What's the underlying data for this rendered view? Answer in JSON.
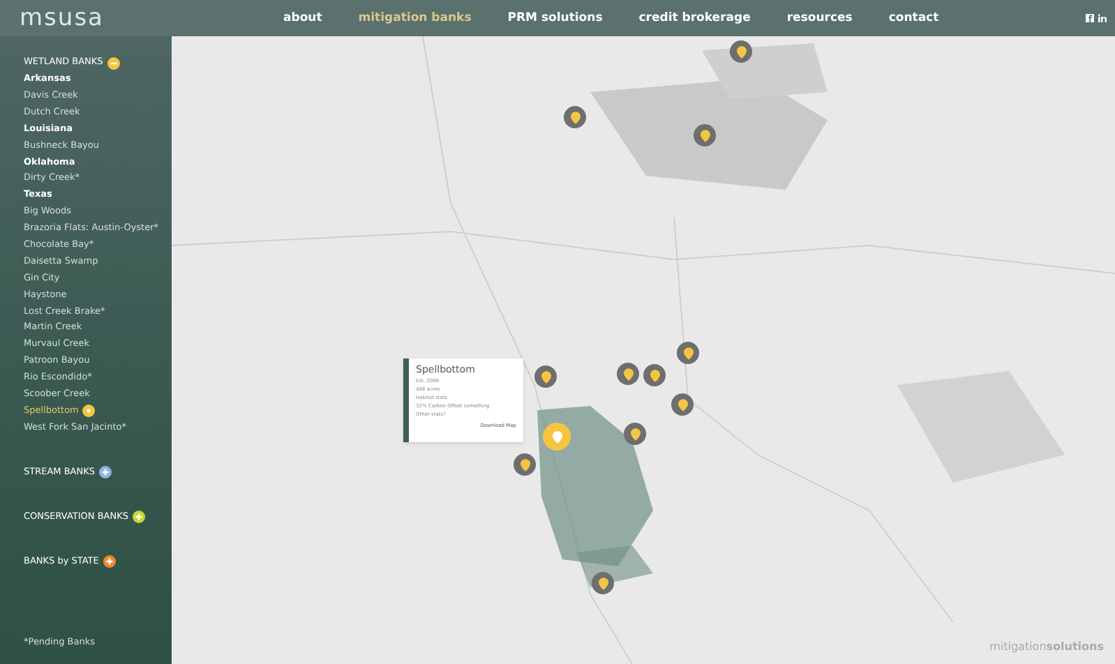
{
  "logo": "msusa",
  "nav": [
    {
      "label": "about",
      "selected": false
    },
    {
      "label": "mitigation banks",
      "selected": true
    },
    {
      "label": "PRM solutions",
      "selected": false
    },
    {
      "label": "credit brokerage",
      "selected": false
    },
    {
      "label": "resources",
      "selected": false
    },
    {
      "label": "contact",
      "selected": false
    }
  ],
  "sidebar": {
    "sections": [
      {
        "title": "WETLAND BANKS",
        "color": "#f5c542",
        "expanded": true,
        "items": [
          {
            "kind": "state",
            "label": "Arkansas"
          },
          {
            "kind": "bank",
            "label": "Davis Creek",
            "selected": false
          },
          {
            "kind": "bank",
            "label": "Dutch Creek",
            "selected": false
          },
          {
            "kind": "state",
            "label": "Louisiana"
          },
          {
            "kind": "bank",
            "label": "Bushneck Bayou",
            "selected": false
          },
          {
            "kind": "state",
            "label": "Oklahoma"
          },
          {
            "kind": "bank",
            "label": "Dirty Creek*",
            "selected": false
          },
          {
            "kind": "state",
            "label": "Texas"
          },
          {
            "kind": "bank",
            "label": "Big Woods",
            "selected": false
          },
          {
            "kind": "bank",
            "label": "Brazoria Flats: Austin-Oyster*",
            "selected": false
          },
          {
            "kind": "bank",
            "label": "Chocolate Bay*",
            "selected": false
          },
          {
            "kind": "bank",
            "label": "Daisetta Swamp",
            "selected": false
          },
          {
            "kind": "bank",
            "label": "Gin City",
            "selected": false
          },
          {
            "kind": "bank",
            "label": "Haystone",
            "selected": false
          },
          {
            "kind": "bank",
            "label": "Lost Creek Brake*",
            "selected": false
          },
          {
            "kind": "bank",
            "label": "Martin Creek",
            "selected": false
          },
          {
            "kind": "bank",
            "label": "Murvaul Creek",
            "selected": false
          },
          {
            "kind": "bank",
            "label": "Patroon Bayou",
            "selected": false
          },
          {
            "kind": "bank",
            "label": "Rio Escondido*",
            "selected": false
          },
          {
            "kind": "bank",
            "label": "Scoober Creek",
            "selected": false
          },
          {
            "kind": "bank",
            "label": "Spellbottom",
            "selected": true
          },
          {
            "kind": "bank",
            "label": "West Fork San Jacinto*",
            "selected": false
          }
        ]
      },
      {
        "title": "STREAM  BANKS",
        "color": "#8fb3e6",
        "expanded": false
      },
      {
        "title": "CONSERVATION BANKS",
        "color": "#c5d93a",
        "expanded": false
      },
      {
        "title": "BANKS by STATE",
        "color": "#f0892a",
        "expanded": false
      }
    ],
    "footnote": "*Pending Banks"
  },
  "map": {
    "pins": [
      {
        "selected": false
      },
      {
        "selected": false
      },
      {
        "selected": false
      },
      {
        "selected": false
      },
      {
        "selected": false
      },
      {
        "selected": false
      },
      {
        "selected": false
      },
      {
        "selected": false
      },
      {
        "selected": false
      },
      {
        "selected": true
      },
      {
        "selected": false
      },
      {
        "selected": false
      }
    ],
    "popup": {
      "title": "Spellbottom",
      "lines": [
        "Est. 2006",
        "406 acres",
        "Habitat stats",
        "32% Carbon Offset something",
        "Other stats?"
      ],
      "link": "Download Map"
    }
  },
  "footer_logo": {
    "light": "mitigation",
    "bold": "solutions"
  }
}
